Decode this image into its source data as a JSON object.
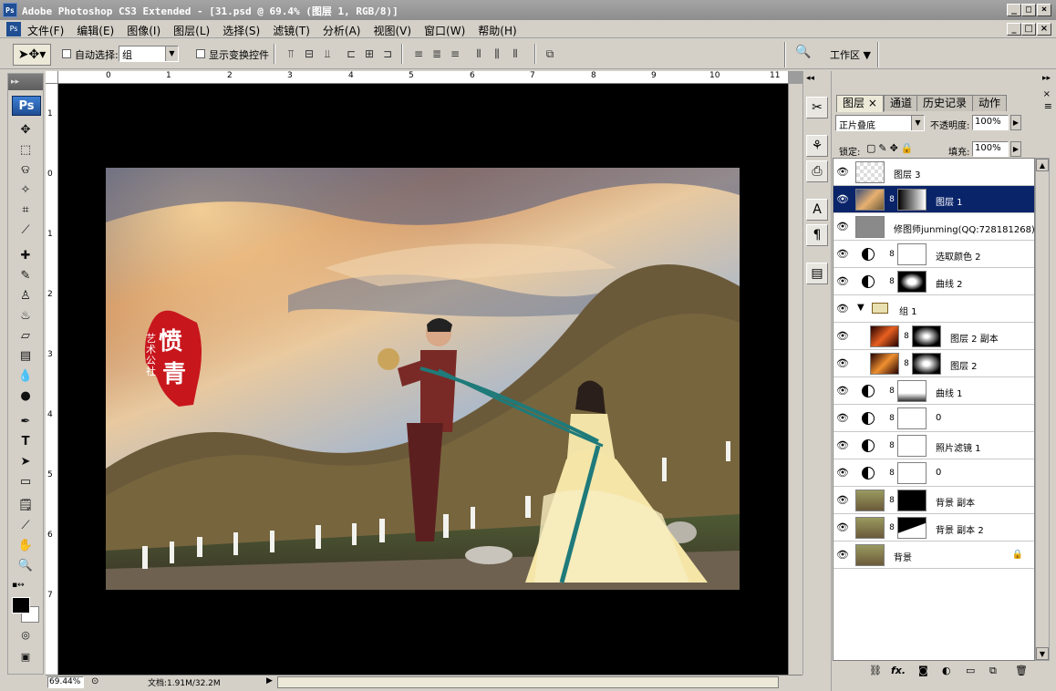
{
  "window": {
    "app_icon": "Ps",
    "title": "Adobe Photoshop CS3 Extended - [31.psd @ 69.4% (图层 1, RGB/8)]",
    "buttons": [
      "_",
      "□",
      "×"
    ]
  },
  "menubar": {
    "items": [
      "文件(F)",
      "编辑(E)",
      "图像(I)",
      "图层(L)",
      "选择(S)",
      "滤镜(T)",
      "分析(A)",
      "视图(V)",
      "窗口(W)",
      "帮助(H)"
    ]
  },
  "options_bar": {
    "auto_select_label": "自动选择:",
    "auto_select_value": "组",
    "show_transform_label": "显示变换控件",
    "workspace_label": "工作区 ▼"
  },
  "toolbox": {
    "header": "▸▸",
    "logo": "Ps",
    "tools": [
      "move-tool",
      "marquee-tool",
      "lasso-tool",
      "magic-wand-tool",
      "crop-tool",
      "slice-tool",
      "healing-brush-tool",
      "brush-tool",
      "clone-stamp-tool",
      "history-brush-tool",
      "eraser-tool",
      "gradient-tool",
      "blur-tool",
      "dodge-tool",
      "pen-tool",
      "type-tool",
      "path-selection-tool",
      "shape-tool",
      "notes-tool",
      "eyedropper-tool",
      "hand-tool",
      "zoom-tool"
    ],
    "type_glyph": "T"
  },
  "ruler": {
    "h_ticks": [
      "0",
      "1",
      "2",
      "3",
      "4",
      "5",
      "6",
      "7",
      "8",
      "9",
      "10",
      "11"
    ],
    "v_ticks": [
      "1",
      "0",
      "1",
      "2",
      "3",
      "4",
      "5",
      "6",
      "7"
    ]
  },
  "photo": {
    "seal_char1": "愤",
    "seal_char2": "青",
    "seal_side": "艺术公社"
  },
  "status": {
    "zoom": "69.44%",
    "doc": "文档:1.91M/32.2M"
  },
  "panel": {
    "tabs": [
      "图层",
      "通道",
      "历史记录",
      "动作"
    ],
    "blend_mode": "正片叠底",
    "opacity_label": "不透明度:",
    "opacity_value": "100%",
    "lock_label": "锁定:",
    "fill_label": "填充:",
    "fill_value": "100%",
    "layers": [
      {
        "name": "图层 3"
      },
      {
        "name": "图层 1"
      },
      {
        "name": "修图师junming(QQ:728181268)"
      },
      {
        "name": "选取颜色 2"
      },
      {
        "name": "曲线 2"
      },
      {
        "name": "组 1"
      },
      {
        "name": "图层 2 副本"
      },
      {
        "name": "图层 2"
      },
      {
        "name": "曲线 1"
      },
      {
        "name": "0"
      },
      {
        "name": "照片滤镜 1"
      },
      {
        "name": "0"
      },
      {
        "name": "背景 副本"
      },
      {
        "name": "背景 副本 2"
      },
      {
        "name": "背景"
      }
    ],
    "bottom_icons": [
      "link-icon",
      "fx-icon",
      "mask-icon",
      "adjustment-icon",
      "folder-icon",
      "new-layer-icon",
      "trash-icon"
    ],
    "fx_label": "fx."
  },
  "colors": {
    "accent": "#0a246a",
    "chrome": "#d4d0c8",
    "title_gradient": "#8d8d8d"
  }
}
